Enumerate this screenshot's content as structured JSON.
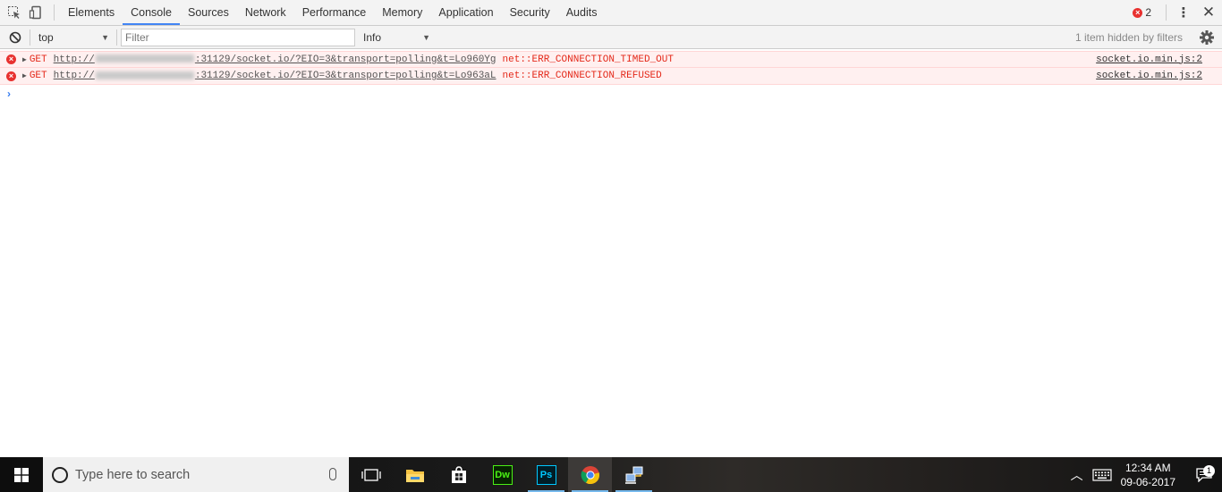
{
  "devtools": {
    "tabs": [
      "Elements",
      "Console",
      "Sources",
      "Network",
      "Performance",
      "Memory",
      "Application",
      "Security",
      "Audits"
    ],
    "active_tab": "Console",
    "error_count": "2",
    "error_badge_icon": "×"
  },
  "console_toolbar": {
    "context": "top",
    "filter_placeholder": "Filter",
    "level": "Info",
    "hidden_note": "1 item hidden by filters"
  },
  "messages": [
    {
      "method": "GET",
      "url_prefix": "http://",
      "url_suffix": ":31129/socket.io/?EIO=3&transport=polling&t=Lo960Yg",
      "error": "net::ERR_CONNECTION_TIMED_OUT",
      "source": "socket.io.min.js:2"
    },
    {
      "method": "GET",
      "url_prefix": "http://",
      "url_suffix": ":31129/socket.io/?EIO=3&transport=polling&t=Lo963aL",
      "error": "net::ERR_CONNECTION_REFUSED",
      "source": "socket.io.min.js:2"
    }
  ],
  "prompt_symbol": "›",
  "taskbar": {
    "search_placeholder": "Type here to search",
    "apps": [
      "task-view",
      "file-explorer",
      "store",
      "dreamweaver",
      "photoshop",
      "chrome",
      "network-app"
    ],
    "dw_label": "Dw",
    "ps_label": "Ps",
    "time": "12:34 AM",
    "date": "09-06-2017",
    "notification_count": "1"
  },
  "colors": {
    "accent": "#4285f4",
    "error": "#e4291a",
    "error_bg": "#fff0f0"
  }
}
